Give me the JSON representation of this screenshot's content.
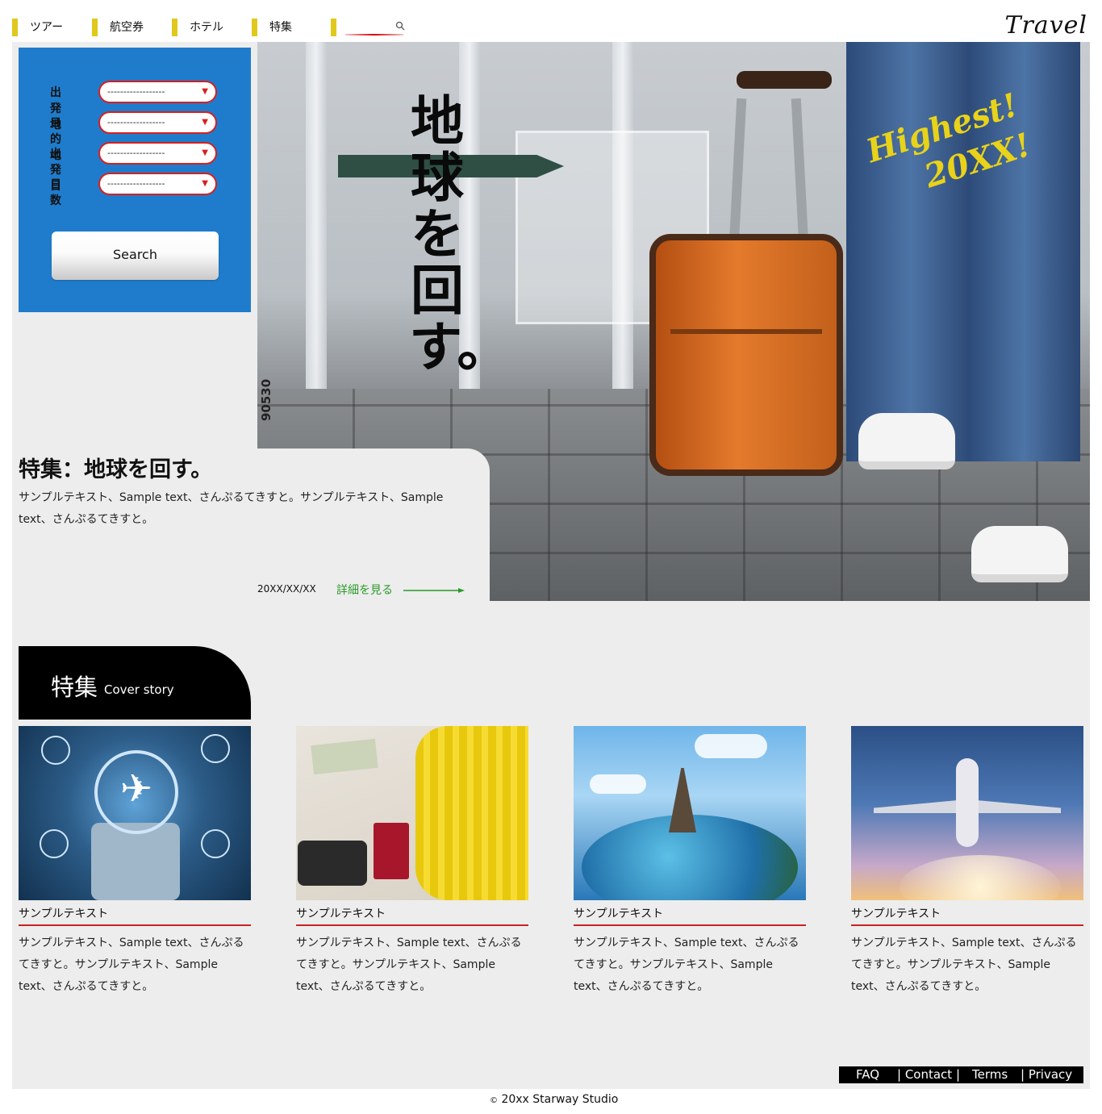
{
  "nav": {
    "items": [
      "ツアー",
      "航空券",
      "ホテル",
      "特集"
    ],
    "search_icon": "search-icon"
  },
  "brand": "Travel",
  "search_panel": {
    "fields": [
      {
        "label": "出発地",
        "value": "------------------"
      },
      {
        "label": "目的地",
        "value": "------------------"
      },
      {
        "label": "出発日",
        "value": "------------------"
      },
      {
        "label": "日数",
        "value": "------------------"
      }
    ],
    "button_label": "Search"
  },
  "hero": {
    "vertical_text": "地球を回す。",
    "script_text_1": "Highest!",
    "script_text_2": "20XX!",
    "code": "90530"
  },
  "feature": {
    "title": "特集：地球を回す。",
    "text": "サンプルテキスト、Sample text、さんぷるてきすと。サンプルテキスト、Sample text、さんぷるてきすと。",
    "date": "20XX/XX/XX",
    "more_label": "詳細を見る"
  },
  "section": {
    "title_jp": "特集",
    "title_en": "Cover story"
  },
  "cards": [
    {
      "caption": "サンプルテキスト",
      "text": "サンプルテキスト、Sample text、さんぷるてきすと。サンプルテキスト、Sample text、さんぷるてきすと。"
    },
    {
      "caption": "サンプルテキスト",
      "text": "サンプルテキスト、Sample text、さんぷるてきすと。サンプルテキスト、Sample text、さんぷるてきすと。"
    },
    {
      "caption": "サンプルテキスト",
      "text": "サンプルテキスト、Sample text、さんぷるてきすと。サンプルテキスト、Sample text、さんぷるてきすと。"
    },
    {
      "caption": "サンプルテキスト",
      "text": "サンプルテキスト、Sample text、さんぷるてきすと。サンプルテキスト、Sample text、さんぷるてきすと。"
    }
  ],
  "footer": {
    "links": [
      "FAQ",
      "| Contact |",
      "Terms",
      "| Privacy"
    ],
    "copyright": "20xx Starway Studio"
  },
  "colors": {
    "accent_yellow": "#e0c81c",
    "panel_blue": "#1f7ccc",
    "accent_red": "#c82323",
    "link_green": "#2a9a2a"
  }
}
